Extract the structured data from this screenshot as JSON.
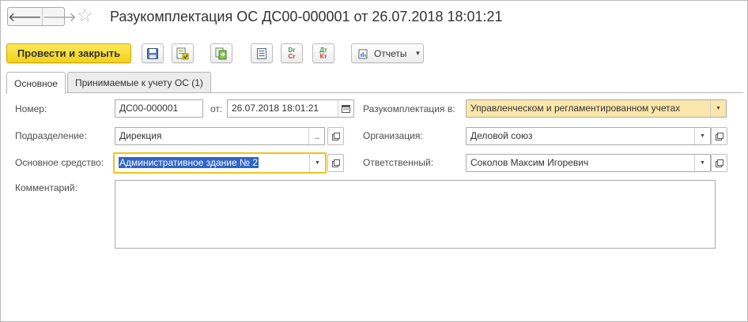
{
  "header": {
    "title": "Разукомплектация ОС ДС00-000001 от 26.07.2018 18:01:21",
    "back_glyph": "🡐",
    "forward_glyph": "🡒",
    "star_glyph": "☆"
  },
  "toolbar": {
    "post_close_label": "Провести и закрыть",
    "reports_label": "Отчеты",
    "dtkt_top": "Дт",
    "dtkt_bot": "Кт",
    "drcr_top": "Dr",
    "drcr_bot": "Cr",
    "accent_color": "#f3d21b"
  },
  "tabs": [
    {
      "label": "Основное"
    },
    {
      "label": "Принимаемые к учету ОС (1)"
    }
  ],
  "form": {
    "number_label": "Номер:",
    "number_value": "ДС00-000001",
    "date_label": "от:",
    "date_value": "26.07.2018 18:01:21",
    "disassembly_label": "Разукомплектация в:",
    "disassembly_value": "Управленческом и регламентированном учетах",
    "department_label": "Подразделение:",
    "department_value": "Дирекция",
    "organization_label": "Организация:",
    "organization_value": "Деловой союз",
    "asset_label": "Основное средство:",
    "asset_value": "Административное здание № 2",
    "responsible_label": "Ответственный:",
    "responsible_value": "Соколов Максим Игоревич",
    "comment_label": "Комментарий:",
    "comment_value": ""
  }
}
